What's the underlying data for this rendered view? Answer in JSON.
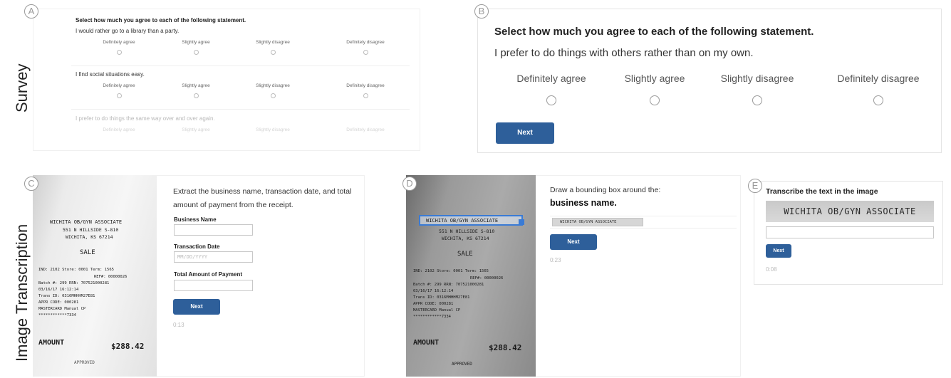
{
  "row_labels": {
    "survey": "Survey",
    "image_transcription": "Image Transcription"
  },
  "panel_letters": {
    "a": "A",
    "b": "B",
    "c": "C",
    "d": "D",
    "e": "E"
  },
  "panel_a": {
    "instruction": "Select how much you agree to each of the following statement.",
    "options": [
      "Definitely agree",
      "Slightly agree",
      "Slightly disagree",
      "Definitely disagree"
    ],
    "questions": [
      "I would rather go to a library than a party.",
      "I find social situations easy.",
      "I prefer to do things the same way over and over again."
    ]
  },
  "panel_b": {
    "instruction": "Select how much you agree to each of the following statement.",
    "question": "I prefer to do things with others rather than on my own.",
    "options": [
      "Definitely agree",
      "Slightly agree",
      "Slightly disagree",
      "Definitely disagree"
    ],
    "next_label": "Next"
  },
  "receipt": {
    "lines": {
      "business": "WICHITA OB/GYN ASSOCIATE",
      "address1": "551 N HILLSIDE S-810",
      "address2": "WICHITA, KS 67214",
      "sale": "SALE",
      "ind": "IND: 2102   Store: 0001   Term: 1565",
      "ref": "REF#: 00000026",
      "batch": "Batch #: 299     RRN: 707521000281",
      "date": "03/16/17                 16:12:14",
      "trans": "Trans ID: 0316MHHHM27E81",
      "appr": "APPR CODE: 000281",
      "card": "MASTERCARD            Manual CP",
      "cardnum": "************7334",
      "amount_label": "AMOUNT",
      "amount_value": "$288.42",
      "approved": "APPROVED"
    }
  },
  "panel_c": {
    "instruction": "Extract the business name, transaction date, and total amount of payment from the receipt.",
    "business_name_label": "Business Name",
    "transaction_date_label": "Transaction Date",
    "transaction_date_placeholder": "MM/DD/YYYY",
    "total_amount_label": "Total Amount of Payment",
    "next_label": "Next",
    "timer": "0:13"
  },
  "panel_d": {
    "instruction": "Draw a bounding box around the:",
    "target": "business name.",
    "crop_text": "WICHITA OB/GYN ASSOCIATE",
    "next_label": "Next",
    "timer": "0:23"
  },
  "panel_e": {
    "instruction": "Transcribe the text in the image",
    "image_text": "WICHITA OB/GYN ASSOCIATE",
    "next_label": "Next",
    "timer": "0:08"
  }
}
